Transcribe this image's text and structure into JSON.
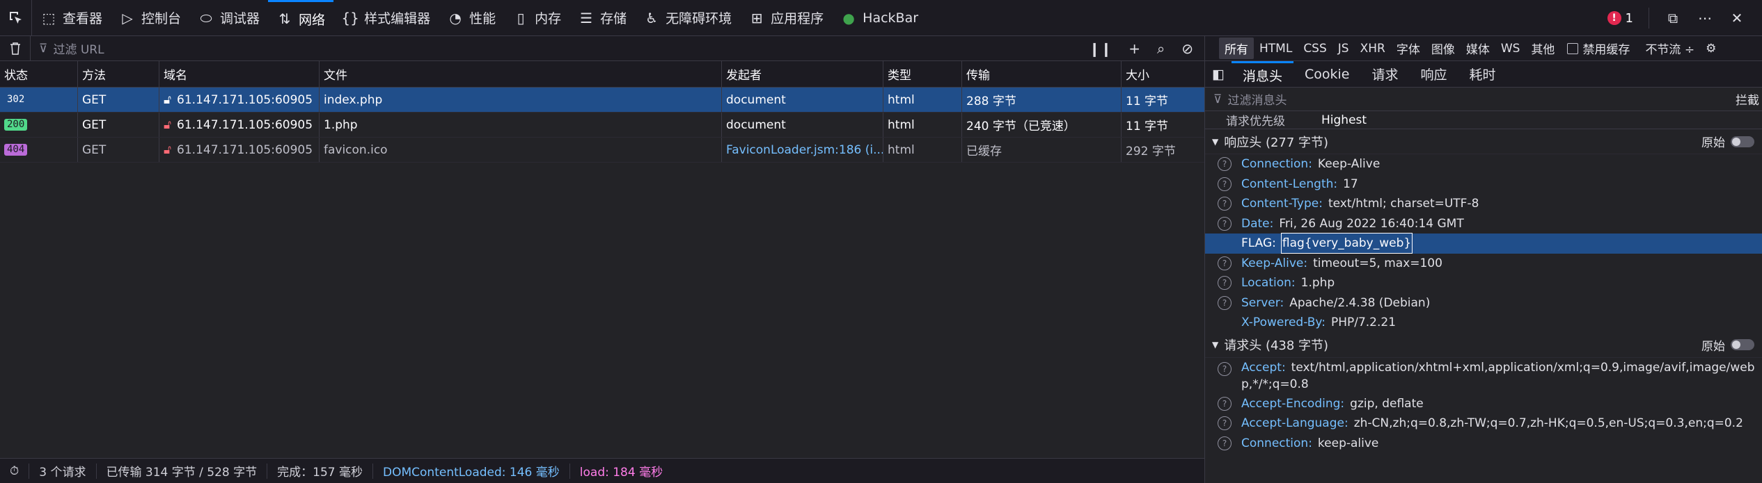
{
  "toolbar": {
    "tabs": [
      {
        "label": "查看器",
        "icon": "inspector-icon"
      },
      {
        "label": "控制台",
        "icon": "console-icon"
      },
      {
        "label": "调试器",
        "icon": "debugger-icon"
      },
      {
        "label": "网络",
        "icon": "network-icon"
      },
      {
        "label": "样式编辑器",
        "icon": "style-editor-icon"
      },
      {
        "label": "性能",
        "icon": "performance-icon"
      },
      {
        "label": "内存",
        "icon": "memory-icon"
      },
      {
        "label": "存储",
        "icon": "storage-icon"
      },
      {
        "label": "无障碍环境",
        "icon": "accessibility-icon"
      },
      {
        "label": "应用程序",
        "icon": "application-icon"
      },
      {
        "label": "HackBar",
        "icon": "hackbar-icon"
      }
    ],
    "active_tab": "网络",
    "error_count": "1"
  },
  "network": {
    "filter_placeholder": "过滤 URL",
    "columns": [
      "状态",
      "方法",
      "域名",
      "文件",
      "发起者",
      "类型",
      "传输",
      "大小"
    ],
    "rows": [
      {
        "status": "302",
        "method": "GET",
        "domain": "61.147.171.105:60905",
        "file": "index.php",
        "initiator": "document",
        "type": "html",
        "transfer": "288 字节",
        "size": "11 字节"
      },
      {
        "status": "200",
        "method": "GET",
        "domain": "61.147.171.105:60905",
        "file": "1.php",
        "initiator": "document",
        "type": "html",
        "transfer": "240 字节（已竞速）",
        "size": "11 字节"
      },
      {
        "status": "404",
        "method": "GET",
        "domain": "61.147.171.105:60905",
        "file": "favicon.ico",
        "initiator": "FaviconLoader.jsm:186 (i...",
        "type": "html",
        "transfer": "已缓存",
        "size": "292 字节"
      }
    ],
    "statusbar": {
      "requests": "3 个请求",
      "transferred": "已传输 314 字节 / 528 字节",
      "finish": "完成：157 毫秒",
      "dcl": "DOMContentLoaded: 146 毫秒",
      "load": "load: 184 毫秒"
    }
  },
  "typefilters": [
    "所有",
    "HTML",
    "CSS",
    "JS",
    "XHR",
    "字体",
    "图像",
    "媒体",
    "WS",
    "其他"
  ],
  "disable_cache": "禁用缓存",
  "throttle": "不节流 ÷",
  "details": {
    "tabs": [
      "消息头",
      "Cookie",
      "请求",
      "响应",
      "耗时"
    ],
    "filter_placeholder": "过滤消息头",
    "block_label": "拦截",
    "priority_label": "请求优先级",
    "priority_value": "Highest",
    "response_section": "响应头 (277 字节)",
    "request_section": "请求头 (438 字节)",
    "raw_label": "原始",
    "response_headers": [
      {
        "name": "Connection:",
        "value": "Keep-Alive"
      },
      {
        "name": "Content-Length:",
        "value": "17"
      },
      {
        "name": "Content-Type:",
        "value": "text/html; charset=UTF-8"
      },
      {
        "name": "Date:",
        "value": "Fri, 26 Aug 2022 16:40:14 GMT"
      },
      {
        "name": "FLAG:",
        "value": "flag{very_baby_web}"
      },
      {
        "name": "Keep-Alive:",
        "value": "timeout=5, max=100"
      },
      {
        "name": "Location:",
        "value": "1.php"
      },
      {
        "name": "Server:",
        "value": "Apache/2.4.38 (Debian)"
      },
      {
        "name": "X-Powered-By:",
        "value": "PHP/7.2.21"
      }
    ],
    "request_headers": [
      {
        "name": "Accept:",
        "value": "text/html,application/xhtml+xml,application/xml;q=0.9,image/avif,image/webp,*/*;q=0.8"
      },
      {
        "name": "Accept-Encoding:",
        "value": "gzip, deflate"
      },
      {
        "name": "Accept-Language:",
        "value": "zh-CN,zh;q=0.8,zh-TW;q=0.7,zh-HK;q=0.5,en-US;q=0.3,en;q=0.2"
      },
      {
        "name": "Connection:",
        "value": "keep-alive"
      }
    ]
  }
}
